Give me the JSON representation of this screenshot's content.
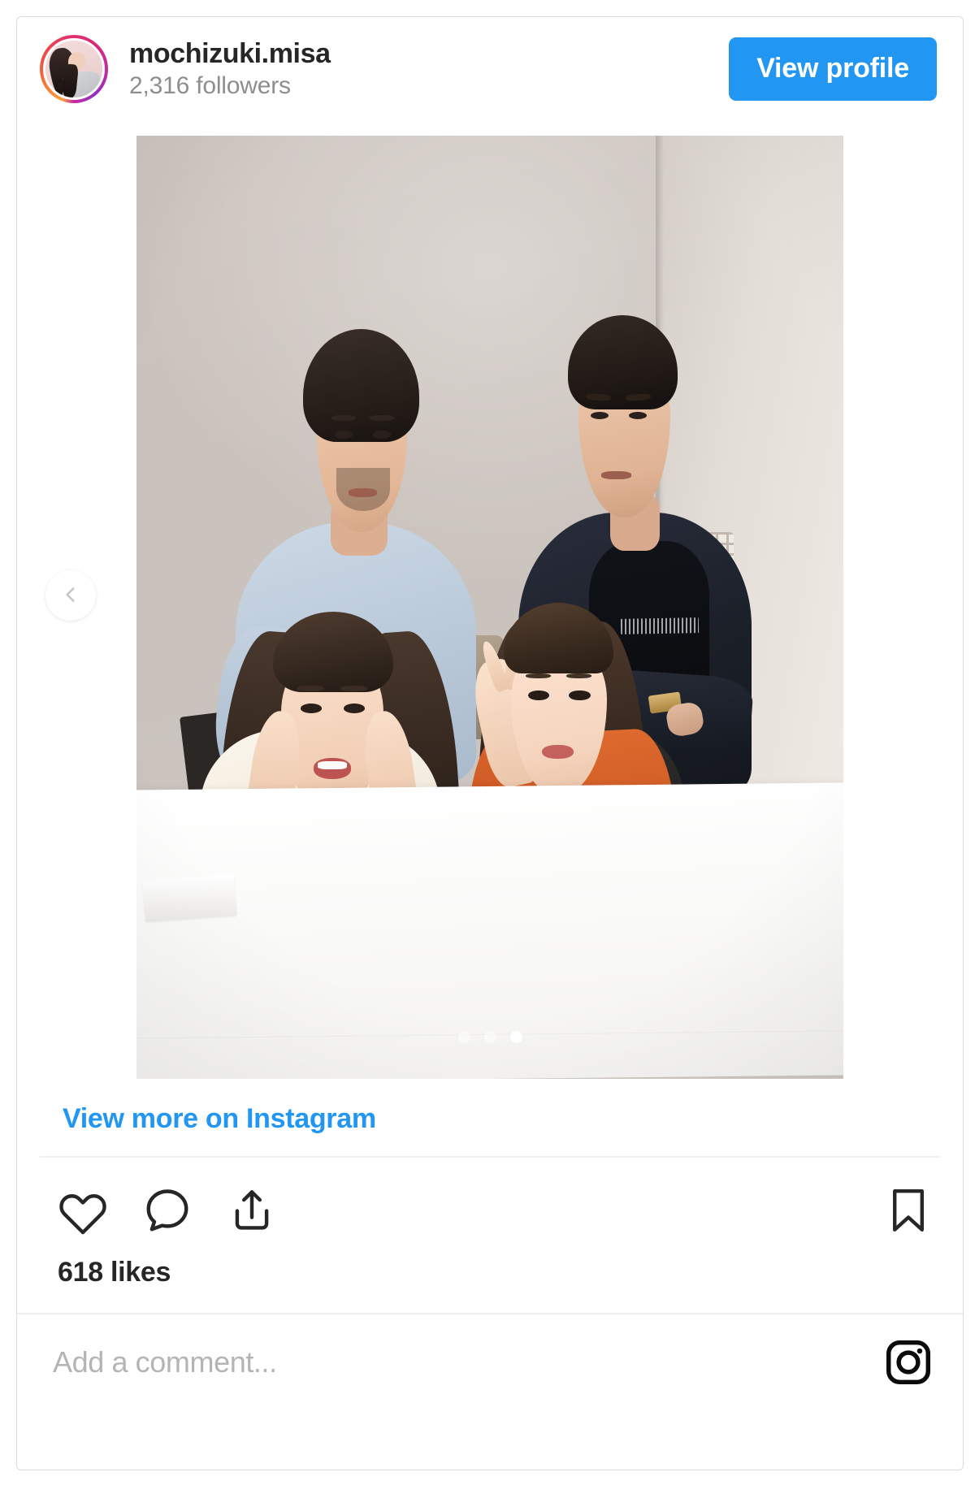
{
  "card": {
    "platform": "instagram-embed",
    "accent_color": "#2196f3",
    "border_color": "#dbdbdb",
    "text_color": "#262626",
    "muted_color": "#8e8e8e"
  },
  "header": {
    "avatar_name": "profile-avatar",
    "username": "mochizuki.misa",
    "followers": "2,316 followers",
    "view_profile_label": "View profile"
  },
  "media": {
    "type": "carousel",
    "alt": "Four people posing together in a bright beige room behind a white table",
    "prev_icon": "chevron-left-icon",
    "dot_count": 3,
    "active_dot_index": 3,
    "dots": [
      {
        "index": 1,
        "active": false
      },
      {
        "index": 2,
        "active": false
      },
      {
        "index": 3,
        "active": true
      }
    ]
  },
  "link": {
    "view_more_label": "View more on Instagram"
  },
  "actions": {
    "like_icon": "heart-icon",
    "comment_icon": "comment-bubble-icon",
    "share_icon": "share-icon",
    "save_icon": "bookmark-icon",
    "likes_text": "618 likes"
  },
  "comment": {
    "placeholder": "Add a comment...",
    "value": "",
    "logo_icon": "instagram-logo-icon"
  }
}
